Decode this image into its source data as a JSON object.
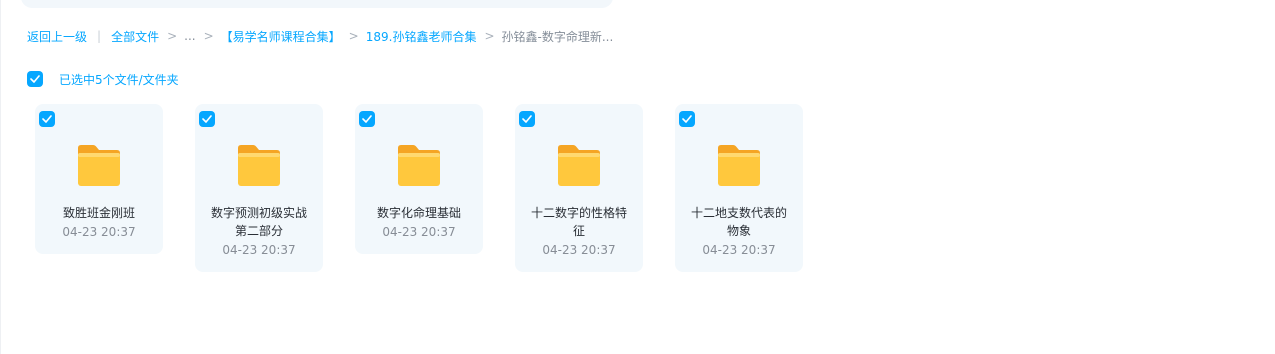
{
  "breadcrumb": {
    "back_label": "返回上一级",
    "root_label": "全部文件",
    "ellipsis": "...",
    "folder_1": "【易学名师课程合集】",
    "folder_2": "189.孙铭鑫老师合集",
    "current": "孙铭鑫-数字命理新..."
  },
  "selection": {
    "label": "已选中5个文件/文件夹",
    "checked": true
  },
  "files": [
    {
      "name": "致胜班金刚班",
      "date": "04-23 20:37",
      "type": "folder",
      "checked": true
    },
    {
      "name": "数字预测初级实战第二部分",
      "date": "04-23 20:37",
      "type": "folder",
      "checked": true
    },
    {
      "name": "数字化命理基础",
      "date": "04-23 20:37",
      "type": "folder",
      "checked": true
    },
    {
      "name": "十二数字的性格特征",
      "date": "04-23 20:37",
      "type": "folder",
      "checked": true
    },
    {
      "name": "十二地支数代表的物象",
      "date": "04-23 20:37",
      "type": "folder",
      "checked": true
    }
  ],
  "colors": {
    "accent": "#06a7ff",
    "card_background": "#f2f8fc",
    "folder_yellow": "#ffc83d"
  },
  "icons": {
    "checkbox": "check-icon",
    "folder": "folder-icon",
    "separator": "chevron-right-icon"
  }
}
